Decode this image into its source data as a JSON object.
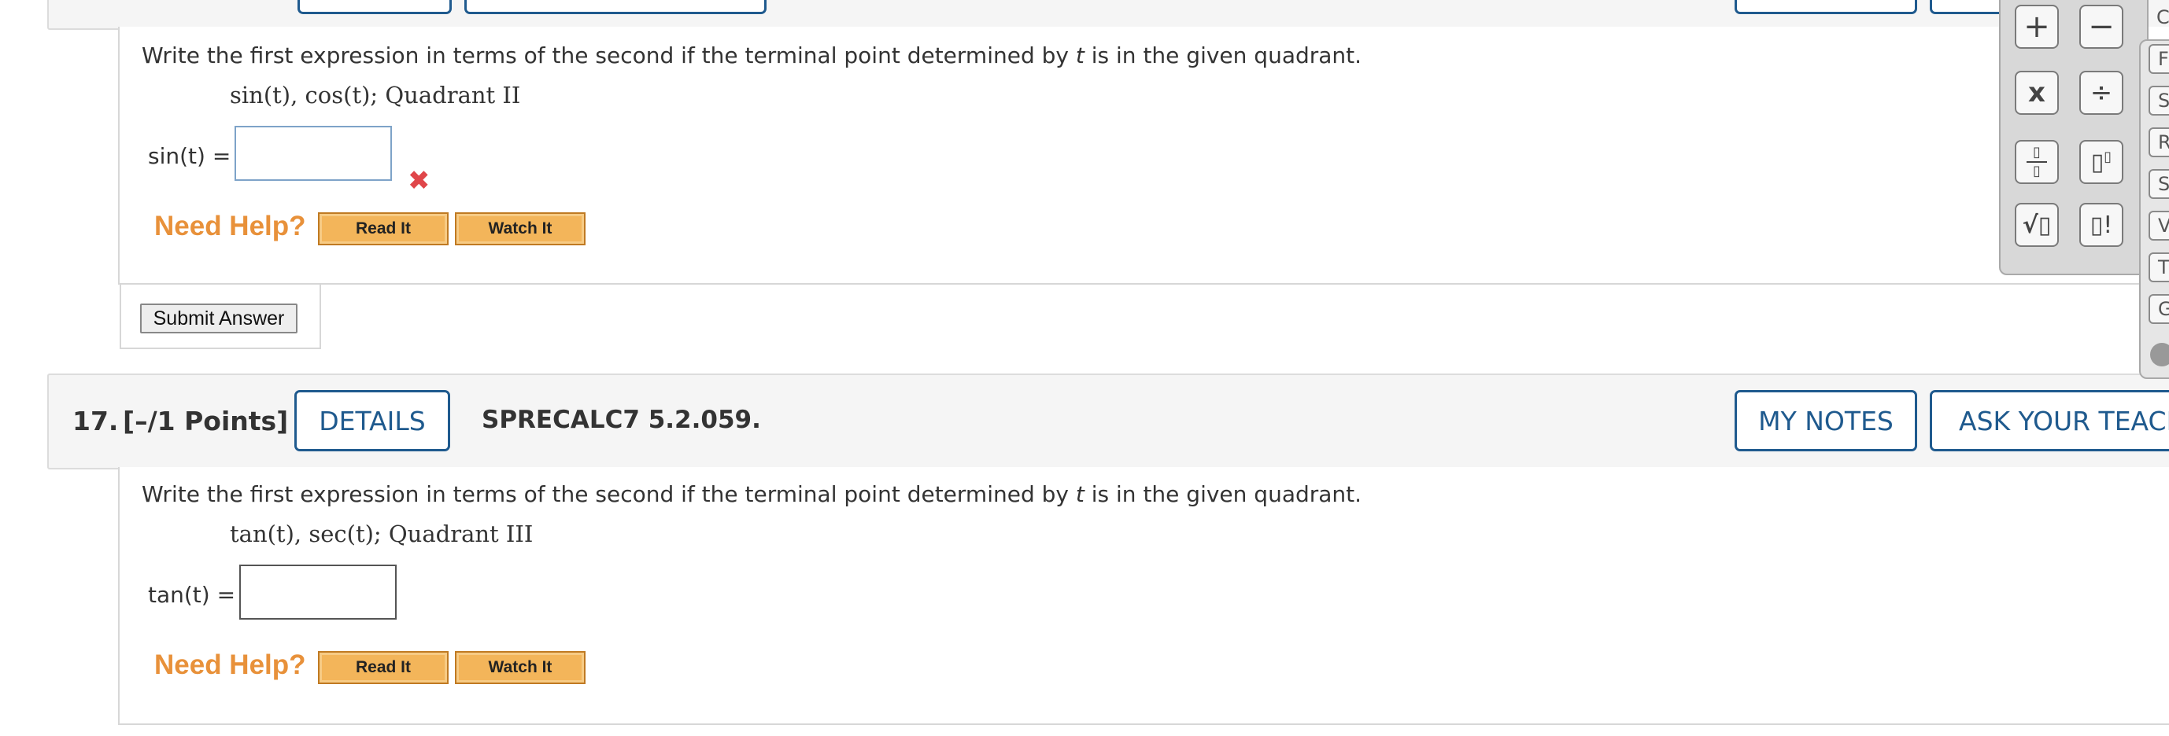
{
  "q16": {
    "question_text_pre": "Write the first expression in terms of the second if the terminal point determined by ",
    "question_var": "t",
    "question_text_post": " is in the given quadrant.",
    "expression": "sin(t), cos(t);  Quadrant II",
    "answer_label": "sin(t) =",
    "answer_value": "",
    "status_mark": "✖",
    "need_help": "Need Help?",
    "read_it": "Read It",
    "watch_it": "Watch It",
    "submit": "Submit Answer"
  },
  "q17": {
    "number": "17.",
    "points": "[–/1 Points]",
    "details": "DETAILS",
    "code": "SPRECALC7 5.2.059.",
    "my_notes": "MY NOTES",
    "ask_teacher": "ASK YOUR TEACH",
    "question_text_pre": "Write the first expression in terms of the second if the terminal point determined by ",
    "question_var": "t",
    "question_text_post": " is in the given quadrant.",
    "expression": "tan(t), sec(t);  Quadrant III",
    "answer_label": "tan(t) =",
    "answer_value": "",
    "need_help": "Need Help?",
    "read_it": "Read It",
    "watch_it": "Watch It"
  },
  "calculator": {
    "plus": "+",
    "minus": "−",
    "times": "x",
    "divide": "÷",
    "fraction": "▯/▯",
    "exponent": "▯▯",
    "sqrt": "√▯",
    "factorial": "▯!"
  },
  "side_tabs": [
    "C",
    "F",
    "S",
    "R",
    "S",
    "V",
    "T",
    "G"
  ],
  "colors": {
    "accent_blue": "#1f5a8e",
    "need_help_orange": "#e8913a",
    "error_red": "#e0464a",
    "help_button": "#f3b55a"
  }
}
